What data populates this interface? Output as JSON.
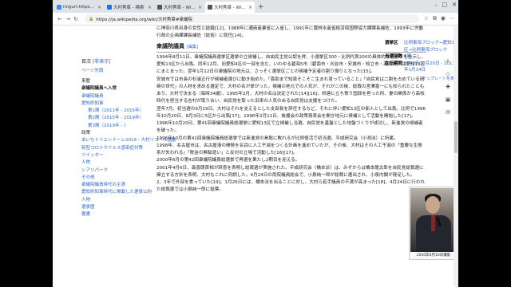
{
  "tabs": [
    {
      "label": "imgurl:https://th.bing.com/th/id/OIP",
      "color": "#4285f4",
      "active": false
    },
    {
      "label": "大村秀章 - 検索",
      "color": "#1a73e8",
      "active": false
    },
    {
      "label": "大村秀章 - Wikipedia",
      "color": "#555555",
      "active": false
    },
    {
      "label": "大村秀章 - Wikipedia",
      "color": "#555555",
      "active": true
    }
  ],
  "address": {
    "url": "https://ja.wikipedia.org/wiki/大村秀章#衆議院"
  },
  "sidebar": {
    "toc_title": "目次",
    "toc_toggle": "[非表示]",
    "hide": "ページ先頭",
    "items": [
      {
        "label": "来歴",
        "kind": "sec"
      },
      {
        "label": "衆議院議員へ入党",
        "kind": "cur"
      },
      {
        "label": "衆議院議員",
        "kind": "item"
      },
      {
        "label": "愛知県知事",
        "kind": "item"
      },
      {
        "label": "第1期（2011年 - 2015年）",
        "kind": "sub"
      },
      {
        "label": "第2期（2015年 - 2019年）",
        "kind": "sub"
      },
      {
        "label": "第3期（2019年 - ）",
        "kind": "sub"
      },
      {
        "label": "政策",
        "kind": "sec"
      },
      {
        "label": "あいちトリエンナーレ2019・大村リコール運動",
        "kind": "item"
      },
      {
        "label": "新型コロナウイルス感染症対策",
        "kind": "item"
      },
      {
        "label": "ツイッター",
        "kind": "item"
      },
      {
        "label": "人物",
        "kind": "item"
      },
      {
        "label": "シアリパーク",
        "kind": "item"
      },
      {
        "label": "その他",
        "kind": "item"
      },
      {
        "label": "衆議院議員時代の主張",
        "kind": "item"
      },
      {
        "label": "愛知県知事時代に掲載した選挙公約",
        "kind": "item"
      },
      {
        "label": "人物",
        "kind": "item"
      },
      {
        "label": "選挙歴",
        "kind": "item"
      },
      {
        "label": "著書",
        "kind": "item"
      }
    ]
  },
  "article": {
    "intro": "に神奈川県出身の女性と結婚[12]。1988年に通商産業省に入省し、1991年に農林水産省経済局国際協力課課長補佐、1993年に労働行政の企画課課長補佐（総括）に就任[14]。",
    "section_title": "衆議院議員",
    "section_edit": "[編集]",
    "paragraphs": [
      "1994年8月11日、衆議院議員選挙区選挙の立候補し、自由民主党公認を得、小選挙区300・比例代表200の具体的な区割りを告示し、愛知13区から出馬。同年12月、旧愛知4区の一部を含む、いわゆる碧海5市（碧南市・刈谷市・安城市・知立市・高浜市）は愛知13区にまとまった。翌年1月12日の衆議院の地元は、さっそく選挙区ごとの候補予定者の割り振りとなった[15]。",
      "安城市では市長の杉浦正行が候補者選びに動き始めた。「喜助まで知恵そこそこ生まれ育っていること」「自民党は二割を占めている岡崎の世代」の人材を求める選定で、大村の名が挙がった。候補の地元での人気が、それがこの後、総裁の宮澤喜一にも知られたこともあり、大村で決まる（毎時34歳）、1995年2月、大村の名は決定された[14][16]。県連に立ち寄り国政を担った所、妻の関係から高校時代を担当する吉村が取り合い、自民党を取った旧来の人気のある自民党は支援をつけた。",
      "翌年7月、初当選の9月29日、大村はそれを支えるとした支部長を辞任するなど、それに伴い愛知13区の新人として出馬。比例で1996年10月20日、8月3日に5区から出馬[17]。1996年2月11日、後援会の政策発表会を開き地元に候補として活動を開始した[17]。1996年10月20日、第41回衆議院議員総選挙に愛知13区で立候補し当選。自民党を基盤とした地盤づくりが成功し、新進党の候補者を破った。",
      "1996年10月の第41回衆議院議員総選挙では新進党の島聡に敗れるが比例復活で初当選。平成研究会（小渕派）に所属。",
      "1998年、名古屋市は、名古屋港の開発を名目に人工干潟をつくる計画を進めていたが、その後、大村はその人工干潟の「重要な生態系が失われる」「税金の無駄遣い」と反対の立場で活動した[16][17]。",
      "2000年6月の第42回衆議院議員総選挙で再選を果たし2期目を迎える。",
      "2001年4月6日、森喜朗首相が辞意を表明し総裁選が実施された。平成研究会（橋本派）は、みずからは橋本龍太郎を自民党総裁選に擁立する方針を表明、大村もこれに同調した。4月24日の両院議員総会で、小泉純一郎が総裁に選出され、小泉内閣が発足した。",
      "2、3年で外部を食っていた[19]。1月26日には、橋本派を出ることに対し、大村ら若手議員の不満が高まった[18]。4月24日に行われた総裁選では小泉純一郎に投票。"
    ]
  },
  "infobox": {
    "rows": [
      {
        "k": "選挙区",
        "v": "比例東海ブロック→愛知13区→比例東海ブロック"
      },
      {
        "k": "当選回数",
        "v": "5回"
      },
      {
        "k": "在任期間",
        "v": "1996年10月20日 - 2011年1月14日"
      }
    ],
    "template": "テンプレートを表示"
  },
  "photo": {
    "caption": "2010年6月10日撮影"
  }
}
